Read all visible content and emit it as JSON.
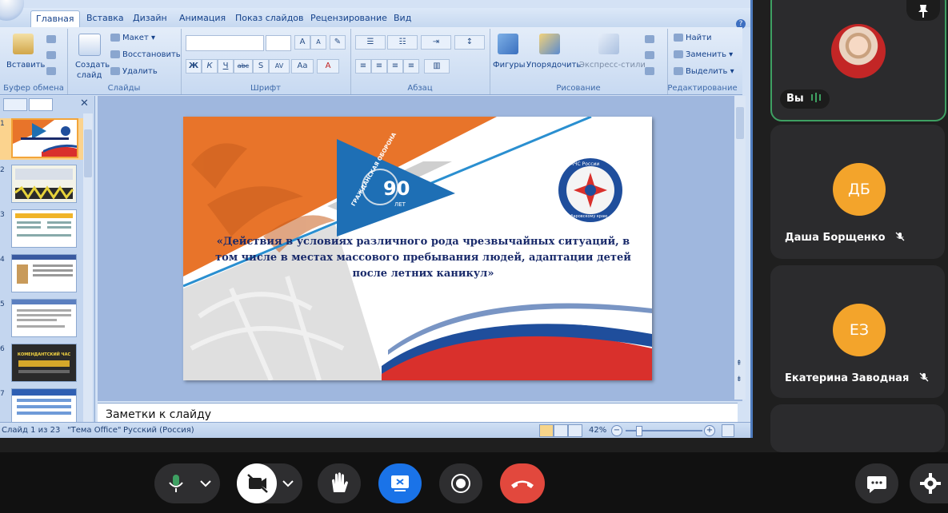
{
  "ribbon": {
    "tabs": [
      "Главная",
      "Вставка",
      "Дизайн",
      "Анимация",
      "Показ слайдов",
      "Рецензирование",
      "Вид"
    ],
    "active_tab": "Главная",
    "clipboard": {
      "paste": "Вставить",
      "group": "Буфер обмена"
    },
    "slides": {
      "new_slide_line1": "Создать",
      "new_slide_line2": "слайд",
      "layout": "Макет",
      "reset": "Восстановить",
      "delete": "Удалить",
      "group": "Слайды"
    },
    "font": {
      "group": "Шрифт",
      "buttons": [
        "Ж",
        "К",
        "Ч",
        "abc",
        "S",
        "AV",
        "Aa",
        "A"
      ],
      "grow": "A",
      "shrink": "A"
    },
    "paragraph": {
      "group": "Абзац"
    },
    "drawing": {
      "shapes": "Фигуры",
      "arrange": "Упорядочить",
      "quick_styles": "Экспресс-стили",
      "group": "Рисование"
    },
    "editing": {
      "find": "Найти",
      "replace": "Заменить",
      "select": "Выделить",
      "group": "Редактирование"
    }
  },
  "thumbnails": {
    "numbers": [
      "1",
      "2",
      "3",
      "4",
      "5",
      "6",
      "7"
    ],
    "selected": "1",
    "thumb6_text": "КОМЕНДАНТСКИЙ ЧАС"
  },
  "slide": {
    "title": "«Действия в условиях различного рода чрезвычайных ситуаций, в том числе в местах массового пребывания людей, адаптации детей после летних каникул»",
    "badge_arc_text": "ГРАЖДАНСКАЯ ОБОРОНА",
    "badge_number": "90",
    "badge_sub": "ЛЕТ",
    "emblem_top": "ГУ МЧС России",
    "emblem_bottom": "по Хабаровскому краю"
  },
  "notes": {
    "placeholder": "Заметки к слайду"
  },
  "status": {
    "slide_counter": "Слайд 1 из 23",
    "theme": "\"Тема Office\"",
    "language": "Русский (Россия)",
    "zoom_label": "42%",
    "zoom_level_percent": 42
  },
  "participants": [
    {
      "name": "Вы",
      "type": "self"
    },
    {
      "name": "Даша Борщенко",
      "initials": "ДБ",
      "muted": true
    },
    {
      "name": "Екатерина Заводная",
      "initials": "ЕЗ",
      "muted": true
    }
  ],
  "colors": {
    "accent_orange": "#e8742a",
    "avatar_orange": "#f3a42b",
    "end_call_red": "#e2483d",
    "present_blue": "#1a73e8",
    "speaking_green": "#3ea062"
  }
}
